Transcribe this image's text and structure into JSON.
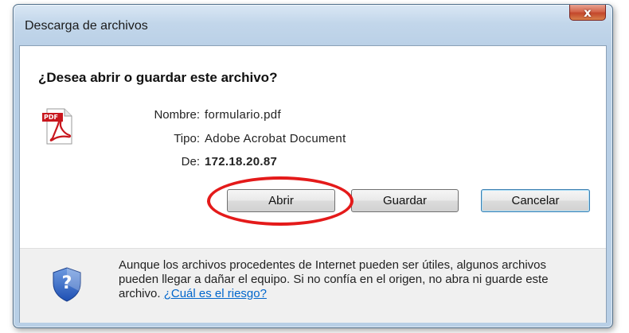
{
  "window": {
    "title": "Descarga de archivos",
    "close_label": "x"
  },
  "dialog": {
    "question": "¿Desea abrir o guardar este archivo?",
    "file_icon": "pdf-icon",
    "file_icon_text": "PDF",
    "fields": [
      {
        "label": "Nombre:",
        "value": "formulario.pdf"
      },
      {
        "label": "Tipo:",
        "value": "Adobe Acrobat Document"
      },
      {
        "label": "De:",
        "value": "172.18.20.87"
      }
    ],
    "buttons": {
      "open": "Abrir",
      "save": "Guardar",
      "cancel": "Cancelar"
    }
  },
  "footer": {
    "icon": "shield-question-icon",
    "icon_glyph": "?",
    "warning_text": "Aunque los archivos procedentes de Internet pueden ser útiles, algunos archivos pueden llegar a dañar el equipo. Si no confía en el origen, no abra ni guarde este archivo.",
    "risk_link": "¿Cuál es el riesgo?"
  },
  "colors": {
    "annotation_ring": "#e41a1a",
    "link": "#0066cc",
    "close_button": "#c3472c"
  }
}
